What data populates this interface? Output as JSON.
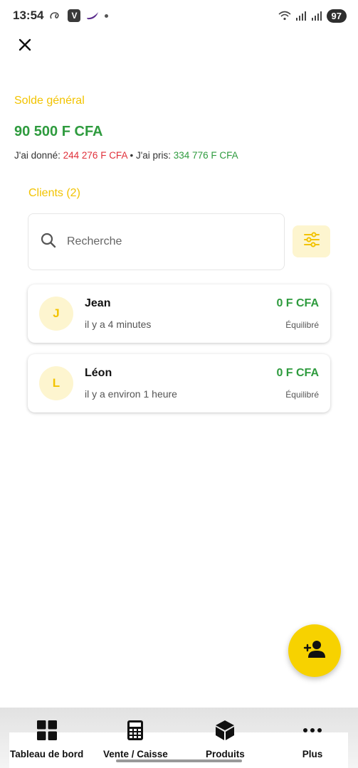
{
  "status_bar": {
    "time": "13:54",
    "app_badge": "V",
    "battery": "97",
    "icons": [
      "at-icon",
      "v-app-icon",
      "bird-icon",
      "dot-icon",
      "wifi-icon",
      "signal-icon",
      "signal-icon-2",
      "battery-icon"
    ]
  },
  "header": {
    "close_icon": "close-icon"
  },
  "balance": {
    "label": "Solde général",
    "value": "90 500 F CFA",
    "given_label": "J'ai donné: ",
    "given_value": "244 276 F CFA",
    "separator": " • ",
    "taken_label": "J'ai pris: ",
    "taken_value": "334 776 F CFA"
  },
  "clients": {
    "title": "Clients (2)",
    "search": {
      "placeholder": "Recherche"
    },
    "items": [
      {
        "initial": "J",
        "name": "Jean",
        "time": "il y a 4 minutes",
        "amount": "0 F CFA",
        "status": "Équilibré"
      },
      {
        "initial": "L",
        "name": "Léon",
        "time": "il y a environ 1 heure",
        "amount": "0 F CFA",
        "status": "Équilibré"
      }
    ]
  },
  "fab": {
    "icon": "add-person-icon"
  },
  "bottom_nav": {
    "items": [
      {
        "label": "Tableau de bord",
        "icon": "dashboard-grid-icon"
      },
      {
        "label": "Vente / Caisse",
        "icon": "calculator-icon"
      },
      {
        "label": "Produits",
        "icon": "box-icon"
      },
      {
        "label": "Plus",
        "icon": "more-dots-icon"
      }
    ]
  },
  "colors": {
    "accent_yellow": "#f2c300",
    "fab_yellow": "#f7d200",
    "positive_green": "#2e9b3e",
    "negative_red": "#e0303a",
    "avatar_bg": "#fdf5cf"
  }
}
